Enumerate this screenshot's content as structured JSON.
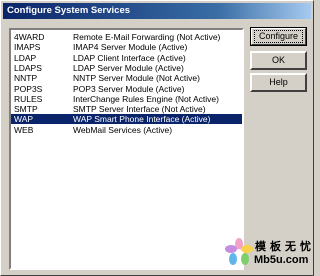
{
  "window": {
    "title": "Configure System Services"
  },
  "services": [
    {
      "code": "4WARD",
      "description": "Remote E-Mail Forwarding (Not Active)",
      "selected": false
    },
    {
      "code": "IMAPS",
      "description": "IMAP4 Server Module (Active)",
      "selected": false
    },
    {
      "code": "LDAP",
      "description": "LDAP Client Interface (Active)",
      "selected": false
    },
    {
      "code": "LDAPS",
      "description": "LDAP Server Module (Active)",
      "selected": false
    },
    {
      "code": "NNTP",
      "description": "NNTP Server Module (Not Active)",
      "selected": false
    },
    {
      "code": "POP3S",
      "description": "POP3 Server Module (Active)",
      "selected": false
    },
    {
      "code": "RULES",
      "description": "InterChange Rules Engine (Not Active)",
      "selected": false
    },
    {
      "code": "SMTP",
      "description": "SMTP Server Interface (Not Active)",
      "selected": false
    },
    {
      "code": "WAP",
      "description": "WAP Smart Phone Interface (Active)",
      "selected": true
    },
    {
      "code": "WEB",
      "description": "WebMail Services (Active)",
      "selected": false
    }
  ],
  "buttons": {
    "configure": "Configure",
    "ok": "OK",
    "help": "Help"
  },
  "watermark": {
    "cn": "模板无忧",
    "en": "Mb5u.com"
  },
  "colors": {
    "selection": "#0a246a",
    "titlebar": "#0a246a",
    "face": "#d4d0c8"
  }
}
